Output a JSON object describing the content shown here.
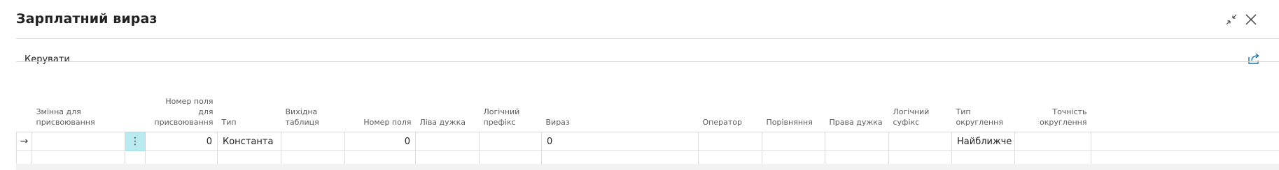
{
  "window": {
    "title": "Зарплатний вираз",
    "collapse_icon": "collapse-arrows-icon",
    "close_icon": "close-icon"
  },
  "actionbar": {
    "manage_label": "Керувати",
    "share_icon": "share-icon"
  },
  "table": {
    "columns": [
      {
        "key": "assign_var",
        "label": "Змінна для присвоювання"
      },
      {
        "key": "assign_field_no",
        "label": "Номер поля для присвоювання"
      },
      {
        "key": "type",
        "label": "Тип"
      },
      {
        "key": "source_table",
        "label": "Вихідна таблиця"
      },
      {
        "key": "field_no",
        "label": "Номер поля"
      },
      {
        "key": "left_bracket",
        "label": "Ліва дужка"
      },
      {
        "key": "logic_prefix",
        "label": "Логічний префікс"
      },
      {
        "key": "expression",
        "label": "Вираз"
      },
      {
        "key": "operator",
        "label": "Оператор"
      },
      {
        "key": "comparison",
        "label": "Порівняння"
      },
      {
        "key": "right_bracket",
        "label": "Права дужка"
      },
      {
        "key": "logic_suffix",
        "label": "Логічний суфікс"
      },
      {
        "key": "rounding_type",
        "label": "Тип округлення"
      },
      {
        "key": "rounding_precision",
        "label": "Точність округлення"
      }
    ],
    "rows": [
      {
        "assign_var": "",
        "assign_field_no": "0",
        "type": "Константа",
        "source_table": "",
        "field_no": "0",
        "left_bracket": "",
        "logic_prefix": "",
        "expression": "0",
        "operator": "",
        "comparison": "",
        "right_bracket": "",
        "logic_suffix": "",
        "rounding_type": "Найближче",
        "rounding_precision": ""
      }
    ],
    "row_marker_icon": "arrow-right-icon",
    "row_menu_icon": "vertical-dots-icon"
  },
  "colors": {
    "selected_cell": "#b9eaf0",
    "grid_border": "#dcdcdc"
  }
}
